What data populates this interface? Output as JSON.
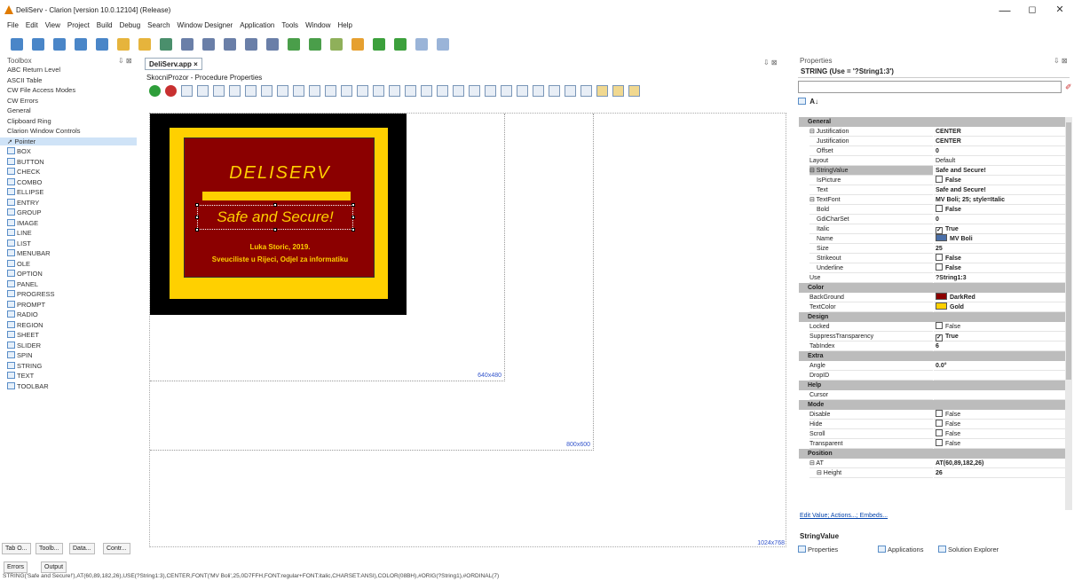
{
  "window": {
    "title": "DeliServ - Clarion [version 10.0.12104] (Release)",
    "minimize": "—",
    "maximize": "◻",
    "close": "✕"
  },
  "menu": [
    "File",
    "Edit",
    "View",
    "Project",
    "Build",
    "Debug",
    "Search",
    "Window Designer",
    "Application",
    "Tools",
    "Window",
    "Help"
  ],
  "toolbox": {
    "title": "Toolbox",
    "pin": "⇩ ⊠",
    "categories": [
      "ABC Return Level",
      "ASCII Table",
      "CW File Access Modes",
      "CW Errors",
      "General",
      "Clipboard Ring",
      "Clarion Window Controls"
    ],
    "selected": "Pointer",
    "controls": [
      "BOX",
      "BUTTON",
      "CHECK",
      "COMBO",
      "ELLIPSE",
      "ENTRY",
      "GROUP",
      "IMAGE",
      "LINE",
      "LIST",
      "MENUBAR",
      "OLE",
      "OPTION",
      "PANEL",
      "PROGRESS",
      "PROMPT",
      "RADIO",
      "REGION",
      "SHEET",
      "SLIDER",
      "SPIN",
      "STRING",
      "TEXT",
      "TOOLBAR"
    ]
  },
  "bottom_tabs": [
    "Tab O...",
    "Toolb...",
    "Data...",
    "Contr..."
  ],
  "error_tabs": [
    "Errors",
    "Output"
  ],
  "status_line": "STRING('Safe and Secure!'),AT(60,89,182,26),USE(?String1:3),CENTER,FONT('MV Boli',25,0D7FFH,FONT:regular+FONT:italic,CHARSET:ANSI),COLOR(08BH),#ORIG(?String1),#ORDINAL(7)",
  "editor": {
    "tab": "DeliServ.app ×",
    "pin": "⇩ ⊠",
    "subtitle": "SkocniProzor - Procedure Properties",
    "size_labels": [
      "640x480",
      "800x600",
      "1024x768"
    ]
  },
  "design_window": {
    "heading": "DELISERV",
    "slogan": "Safe and Secure!",
    "credit1": "Luka Storic, 2019.",
    "credit2": "Sveuciliste u Rijeci, Odjel za informatiku",
    "colors": {
      "outer": "#000000",
      "border": "#FFD000",
      "background": "#8B0000",
      "text": "#FFD000"
    }
  },
  "properties": {
    "title": "Properties",
    "pin": "⇩ ⊠",
    "object": "STRING (Use = '?String1:3')",
    "rows": [
      {
        "t": "cat",
        "n": "General"
      },
      {
        "n": "⊟ Justification",
        "v": "CENTER",
        "b": true
      },
      {
        "n": "Justification",
        "v": "CENTER",
        "b": true,
        "i": 1
      },
      {
        "n": "Offset",
        "v": "0",
        "b": true,
        "i": 1
      },
      {
        "n": "Layout",
        "v": "Default"
      },
      {
        "n": "⊟ StringValue",
        "v": "Safe and Secure!",
        "b": true,
        "sel": true
      },
      {
        "n": "IsPicture",
        "v": "False",
        "cb": false,
        "b": true,
        "i": 1
      },
      {
        "n": "Text",
        "v": "Safe and Secure!",
        "b": true,
        "i": 1
      },
      {
        "n": "⊟ TextFont",
        "v": "MV Boli; 25; style=Italic",
        "b": true
      },
      {
        "n": "Bold",
        "v": "False",
        "cb": false,
        "b": true,
        "i": 1
      },
      {
        "n": "GdiCharSet",
        "v": "0",
        "b": true,
        "i": 1
      },
      {
        "n": "Italic",
        "v": "True",
        "cb": true,
        "b": true,
        "i": 1
      },
      {
        "n": "Name",
        "v": "MV Boli",
        "font": true,
        "b": true,
        "i": 1
      },
      {
        "n": "Size",
        "v": "25",
        "b": true,
        "i": 1
      },
      {
        "n": "Strikeout",
        "v": "False",
        "cb": false,
        "b": true,
        "i": 1
      },
      {
        "n": "Underline",
        "v": "False",
        "cb": false,
        "b": true,
        "i": 1
      },
      {
        "n": "Use",
        "v": "?String1:3",
        "b": true
      },
      {
        "t": "cat",
        "n": "Color"
      },
      {
        "n": "BackGround",
        "v": "DarkRed",
        "sw": "#8B0000",
        "b": true
      },
      {
        "n": "TextColor",
        "v": "Gold",
        "sw": "#FFD000",
        "b": true
      },
      {
        "t": "cat",
        "n": "Design"
      },
      {
        "n": "Locked",
        "v": "False",
        "cb": false
      },
      {
        "n": "SuppressTransparency",
        "v": "True",
        "cb": true,
        "b": true
      },
      {
        "n": "TabIndex",
        "v": "6",
        "b": true
      },
      {
        "t": "cat",
        "n": "Extra"
      },
      {
        "n": "Angle",
        "v": "0.0°",
        "b": true
      },
      {
        "n": "DropID",
        "v": ""
      },
      {
        "t": "cat",
        "n": "Help"
      },
      {
        "n": "Cursor",
        "v": ""
      },
      {
        "t": "cat",
        "n": "Mode"
      },
      {
        "n": "Disable",
        "v": "False",
        "cb": false
      },
      {
        "n": "Hide",
        "v": "False",
        "cb": false
      },
      {
        "n": "Scroll",
        "v": "False",
        "cb": false
      },
      {
        "n": "Transparent",
        "v": "False",
        "cb": false
      },
      {
        "t": "cat",
        "n": "Position"
      },
      {
        "n": "⊟ AT",
        "v": "AT(60,89,182,26)",
        "b": true
      },
      {
        "n": "⊟ Height",
        "v": "26",
        "b": true,
        "i": 1
      }
    ],
    "links": "Edit Value; Actions...; Embeds...",
    "description": "StringValue",
    "tabs": [
      "Properties",
      "Applications",
      "Solution Explorer"
    ]
  }
}
